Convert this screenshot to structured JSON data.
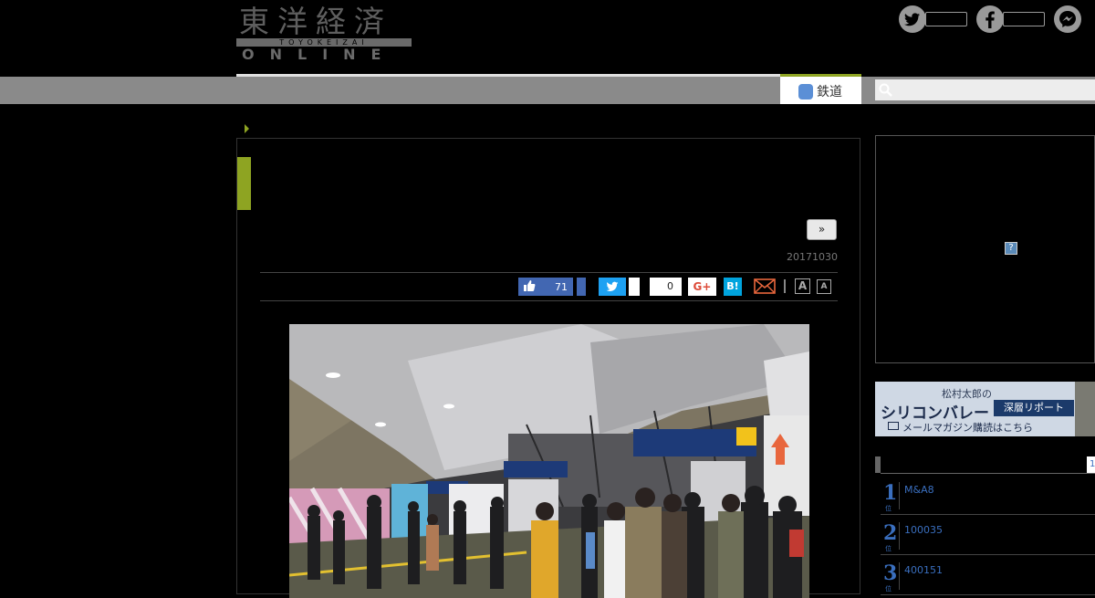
{
  "header": {
    "logo_kanji": "東洋経済",
    "logo_romaji": "TOYOKEIZAI",
    "logo_online": "ONLINE",
    "social": [
      {
        "name": "twitter",
        "glyph": "t"
      },
      {
        "name": "facebook",
        "glyph": "f"
      },
      {
        "name": "messenger",
        "glyph": "m"
      }
    ]
  },
  "nav": {
    "active_tab": "鉄道",
    "search_placeholder": ""
  },
  "article": {
    "next_label": "»",
    "date": "20171030",
    "share": {
      "like_count": "71",
      "tweet_count": "0",
      "gplus_label": "G+",
      "hatena_label": "B!",
      "font_large": "A",
      "font_small": "A"
    }
  },
  "sidebar": {
    "ad_unknown": "?",
    "banner": {
      "line1": "松村太郎の",
      "title": "シリコンバレー",
      "tag": "深層リポート",
      "line3": "メールマガジン購読はこちら"
    },
    "ranking_page": "1",
    "ranking": [
      {
        "rank": "1",
        "suffix": "位",
        "text": "M&A8"
      },
      {
        "rank": "2",
        "suffix": "位",
        "text": "100035"
      },
      {
        "rank": "3",
        "suffix": "位",
        "text": "400151"
      }
    ]
  },
  "colors": {
    "accent": "#8ea422",
    "link": "#3a6fbf",
    "facebook": "#4267b2",
    "twitter": "#1da1f2"
  }
}
